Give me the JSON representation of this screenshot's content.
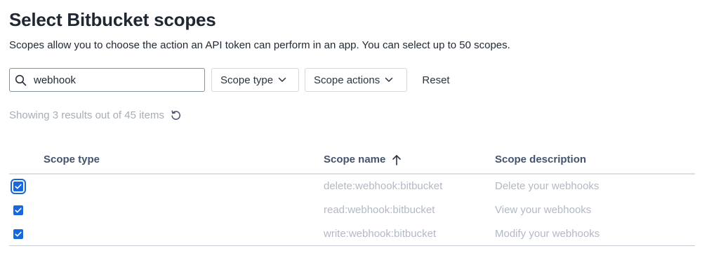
{
  "header": {
    "title": "Select Bitbucket scopes",
    "subtitle": "Scopes allow you to choose the action an API token can perform in an app. You can select up to 50 scopes."
  },
  "filters": {
    "search_value": "webhook",
    "search_icon": "search-icon",
    "scope_type_label": "Scope type",
    "scope_actions_label": "Scope actions",
    "reset_label": "Reset"
  },
  "results": {
    "text": "Showing 3 results out of 45 items",
    "refresh_icon": "refresh-icon"
  },
  "table": {
    "columns": [
      "Scope type",
      "Scope name",
      "Scope description"
    ],
    "sort_column": "Scope name",
    "sort_direction": "ascending",
    "rows": [
      {
        "checked": true,
        "type": "",
        "name": "delete:webhook:bitbucket",
        "description": "Delete your webhooks"
      },
      {
        "checked": true,
        "type": "",
        "name": "read:webhook:bitbucket",
        "description": "View your webhooks"
      },
      {
        "checked": true,
        "type": "",
        "name": "write:webhook:bitbucket",
        "description": "Modify your webhooks"
      }
    ]
  },
  "colors": {
    "accent": "#1868db",
    "muted_text": "#b3b9c4",
    "heading_text": "#44546f"
  }
}
